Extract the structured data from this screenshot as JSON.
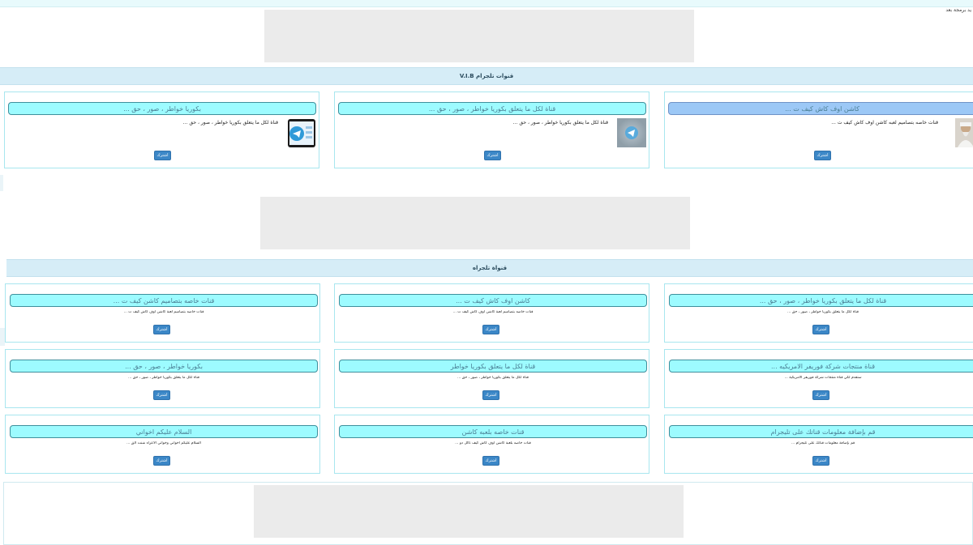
{
  "top_note": "يد برمجة بعد",
  "sections": {
    "vip_title": "قنوات تلجرام V.I.B",
    "free_title": "قنواة تلجراه"
  },
  "join_label": "اشترك",
  "vip_cards": [
    {
      "title": "كاشن اوف كاش كيف ت ...",
      "desc": "قنات خاصه بتصاميم لعبه كاشن اوف كاش كيف ت ...",
      "icon": "sheikh-photo-icon",
      "title_color": "#9cc8f6"
    },
    {
      "title": "قناة لكل ما يتعلق بكوريا خواطر ، صور ، حق ...",
      "desc": "قناة لكل ما يتعلق بكوريا خواطر ، صور ، حق ...",
      "icon": "telegram-blurred-icon",
      "title_color": "#9dfbff"
    },
    {
      "title": "بكوريا خواطر ، صور ، حق ...",
      "desc": "قناة لكل ما يتعلق بكوريا خواطر ، صور ، حق ...",
      "icon": "telegram-phone-icon",
      "title_color": "#9dfbff"
    }
  ],
  "free_rows": [
    [
      {
        "title": "قناة لكل ما يتعلق بكوريا خواطر ، صور ، حق ...",
        "desc": "قناة لكل ما يتعلق بكوريا خواطر ، صور ، حق ..."
      },
      {
        "title": "كاشن اوف كاش كيف ت ...",
        "desc": "قنات خاصه بتصاميم لعبة كاشن اوف كاش كيف ت ..."
      },
      {
        "title": "قنات خاصه بتصاميم كاشن كيف ت ...",
        "desc": "قنات خاصه بتصاميم لعبة كاشن اوف كاش كيف ت ..."
      }
    ],
    [
      {
        "title": "قناة منتجات شركة فوريفر الامريكيه ...",
        "desc": "ستقدم لكي قناة منتجات شركة فوريفر الامريكية ..."
      },
      {
        "title": "قناة لكل ما يتعلق بكوريا خواطر",
        "desc": "قناة لكل ما يتعلق بكوريا خواطر ، صور ، حق ..."
      },
      {
        "title": "بكوريا خواطر ، صور ، حق ...",
        "desc": "قناة لكل ما يتعلق بكوريا خواطر ، صور ، حق ..."
      }
    ],
    [
      {
        "title": "قم بإضافة معلومات قناتك على تليجرام",
        "desc": "قم بإضافة معلومات قناتك على تليجرام ..."
      },
      {
        "title": "قنات خاصه بلعبه كاشن",
        "desc": "قنات خاصه بلعبة كاشن اوف كاش كيف تاكل دو ..."
      },
      {
        "title": "السلام عليكم اخواني",
        "desc": "السلام عليكم اخواني وخواتي الاعزاء شنت الق ..."
      }
    ]
  ],
  "colors": {
    "accent_button": "#3b87c7",
    "title_bg": "#9dfbff",
    "header_bg": "#d6edf7"
  }
}
